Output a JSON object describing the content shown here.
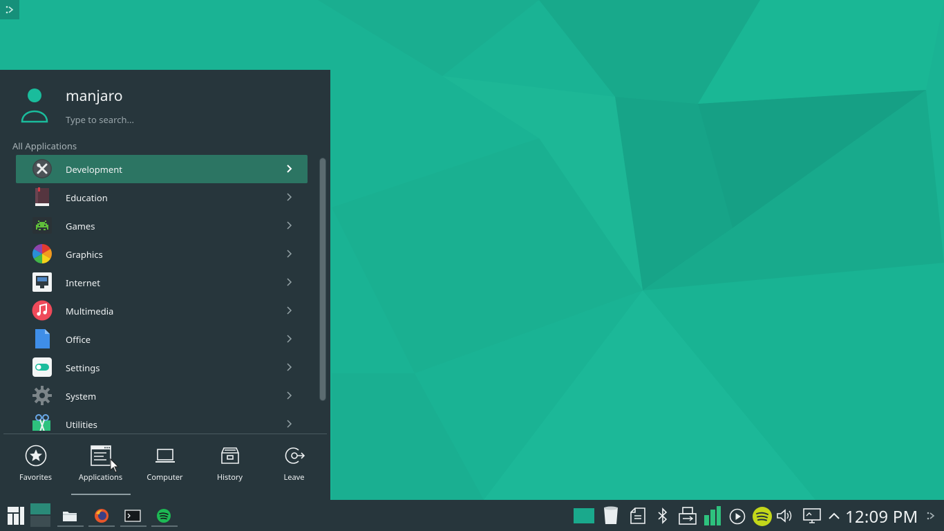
{
  "user": {
    "name": "manjaro"
  },
  "search": {
    "placeholder": "Type to search..."
  },
  "section_label": "All Applications",
  "categories": [
    {
      "label": "Development",
      "icon": "development-tools-icon",
      "active": true
    },
    {
      "label": "Education",
      "icon": "education-book-icon"
    },
    {
      "label": "Games",
      "icon": "games-invader-icon"
    },
    {
      "label": "Graphics",
      "icon": "graphics-color-wheel-icon"
    },
    {
      "label": "Internet",
      "icon": "internet-network-icon"
    },
    {
      "label": "Multimedia",
      "icon": "multimedia-music-note-icon"
    },
    {
      "label": "Office",
      "icon": "office-document-icon"
    },
    {
      "label": "Settings",
      "icon": "settings-toggle-icon"
    },
    {
      "label": "System",
      "icon": "system-gear-icon"
    },
    {
      "label": "Utilities",
      "icon": "utilities-scissors-icon"
    }
  ],
  "tabs": [
    {
      "label": "Favorites",
      "icon": "star-icon"
    },
    {
      "label": "Applications",
      "icon": "applications-window-icon",
      "active": true
    },
    {
      "label": "Computer",
      "icon": "laptop-icon"
    },
    {
      "label": "History",
      "icon": "archive-box-icon"
    },
    {
      "label": "Leave",
      "icon": "leave-exit-icon"
    }
  ],
  "taskbar": {
    "launcher_icon": "manjaro-logo-icon",
    "apps": [
      "file-manager-icon",
      "firefox-icon",
      "terminal-icon",
      "spotify-icon"
    ],
    "tray": [
      "screen-icon",
      "trash-icon",
      "clipboard-icon",
      "bluetooth-icon",
      "usb-icon",
      "system-monitor-icon",
      "media-play-icon",
      "spotify-tray-icon",
      "volume-icon",
      "display-icon",
      "expand-tray-chevron-icon"
    ],
    "clock": "12:09 PM"
  },
  "colors": {
    "desktop": "#1ab394",
    "panel": "#27363c",
    "highlight": "#2c7563",
    "accent": "#1abc9c"
  }
}
